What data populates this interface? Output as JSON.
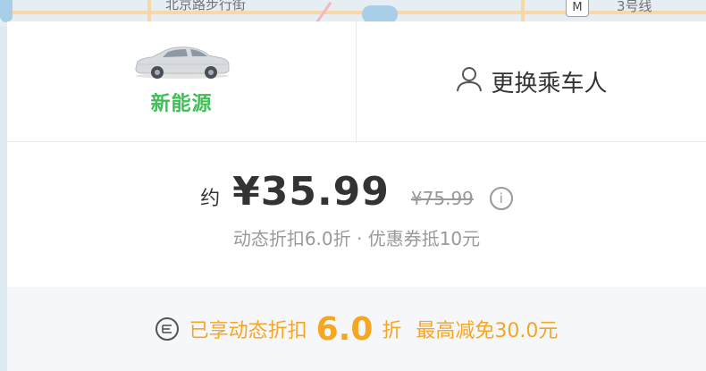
{
  "map": {
    "street_label": "北京路步行街",
    "metro_badge": "M",
    "line_label": "3号线"
  },
  "car": {
    "type_label": "新能源",
    "icon": "car-icon",
    "accent": "#3dbf55"
  },
  "passenger": {
    "label": "更换乘车人",
    "icon": "person-icon"
  },
  "price": {
    "approx_label": "约",
    "amount": "¥35.99",
    "original": "¥75.99",
    "info_icon": "i",
    "sub_text": "动态折扣6.0折 · 优惠券抵10元"
  },
  "discount": {
    "icon": "ticket-icon",
    "prefix": "已享动态折扣",
    "value": "6.0",
    "unit": "折",
    "max": "最高减免30.0元",
    "accent": "#f5a623"
  }
}
